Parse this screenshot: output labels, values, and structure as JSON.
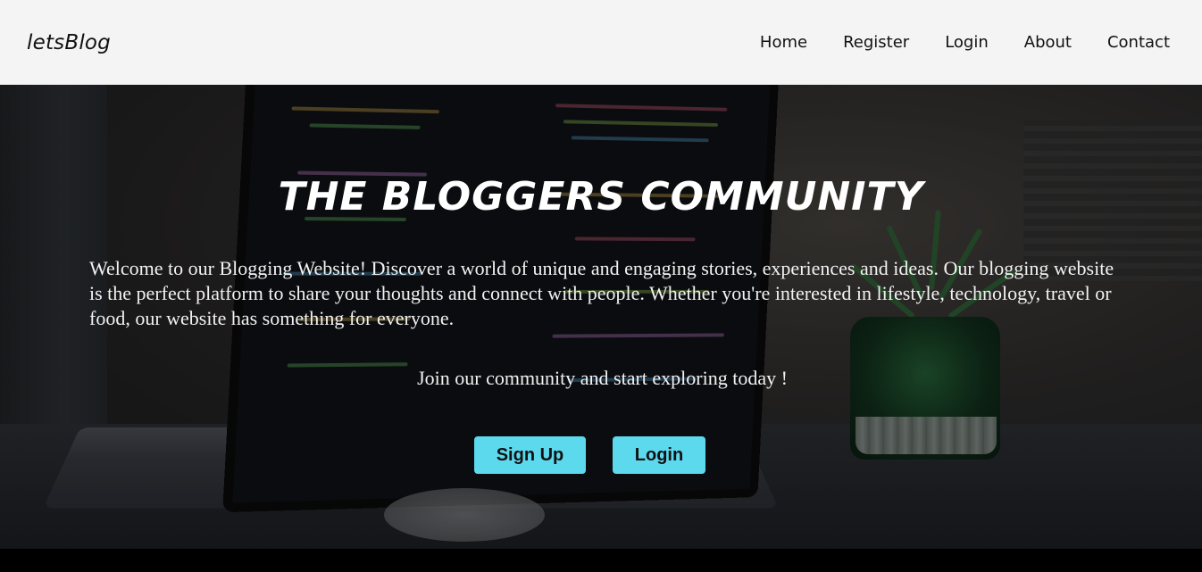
{
  "navbar": {
    "brand": "letsBlog",
    "links": [
      "Home",
      "Register",
      "Login",
      "About",
      "Contact"
    ]
  },
  "hero": {
    "title": "THE BLOGGERS COMMUNITY",
    "description": "Welcome to our Blogging Website! Discover a world of unique and engaging stories, experiences and ideas. Our blogging website is the perfect platform to share your thoughts and connect with people. Whether you're interested in lifestyle, technology, travel or food, our website has something for everyone.",
    "join_text": "Join our community and start exploring today !",
    "signup_label": "Sign Up",
    "login_label": "Login"
  },
  "colors": {
    "navbar_bg": "#f4f4f4",
    "button_bg": "#5dd9ee",
    "hero_text": "#ffffff"
  }
}
